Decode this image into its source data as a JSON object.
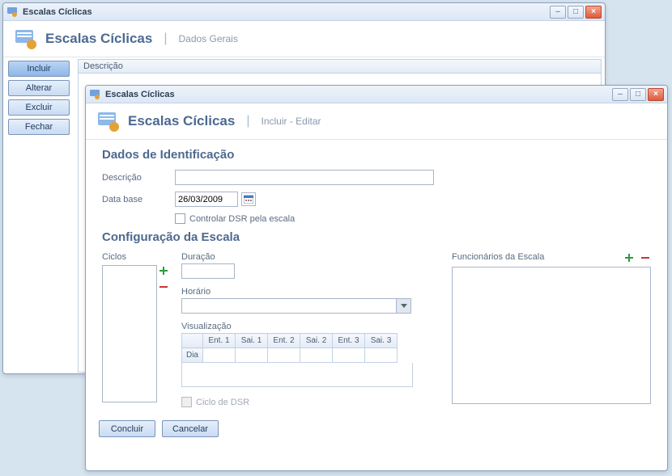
{
  "window1": {
    "title": "Escalas Cíclicas",
    "header": {
      "title": "Escalas Cíclicas",
      "subtitle": "Dados Gerais"
    },
    "sidebar": {
      "incluir": "Incluir",
      "alterar": "Alterar",
      "excluir": "Excluir",
      "fechar": "Fechar"
    },
    "grid": {
      "col_descricao": "Descrição"
    }
  },
  "window2": {
    "title": "Escalas Cíclicas",
    "header": {
      "title": "Escalas Cíclicas",
      "subtitle": "Incluir - Editar"
    },
    "identificacao": {
      "section": "Dados de Identificação",
      "descricao_label": "Descrição",
      "descricao_value": "",
      "database_label": "Data base",
      "database_value": "26/03/2009",
      "controlar_dsr": "Controlar DSR pela escala"
    },
    "config": {
      "section": "Configuração da Escala",
      "ciclos_label": "Ciclos",
      "duracao_label": "Duração",
      "duracao_value": "",
      "horario_label": "Horário",
      "horario_value": "",
      "visualizacao_label": "Visualização",
      "cols": {
        "dia": "Dia",
        "ent1": "Ent. 1",
        "sai1": "Sai. 1",
        "ent2": "Ent. 2",
        "sai2": "Sai. 2",
        "ent3": "Ent. 3",
        "sai3": "Sai. 3"
      },
      "ciclo_dsr": "Ciclo de DSR",
      "funcionarios_label": "Funcionários da Escala"
    },
    "buttons": {
      "concluir": "Concluir",
      "cancelar": "Cancelar"
    }
  }
}
